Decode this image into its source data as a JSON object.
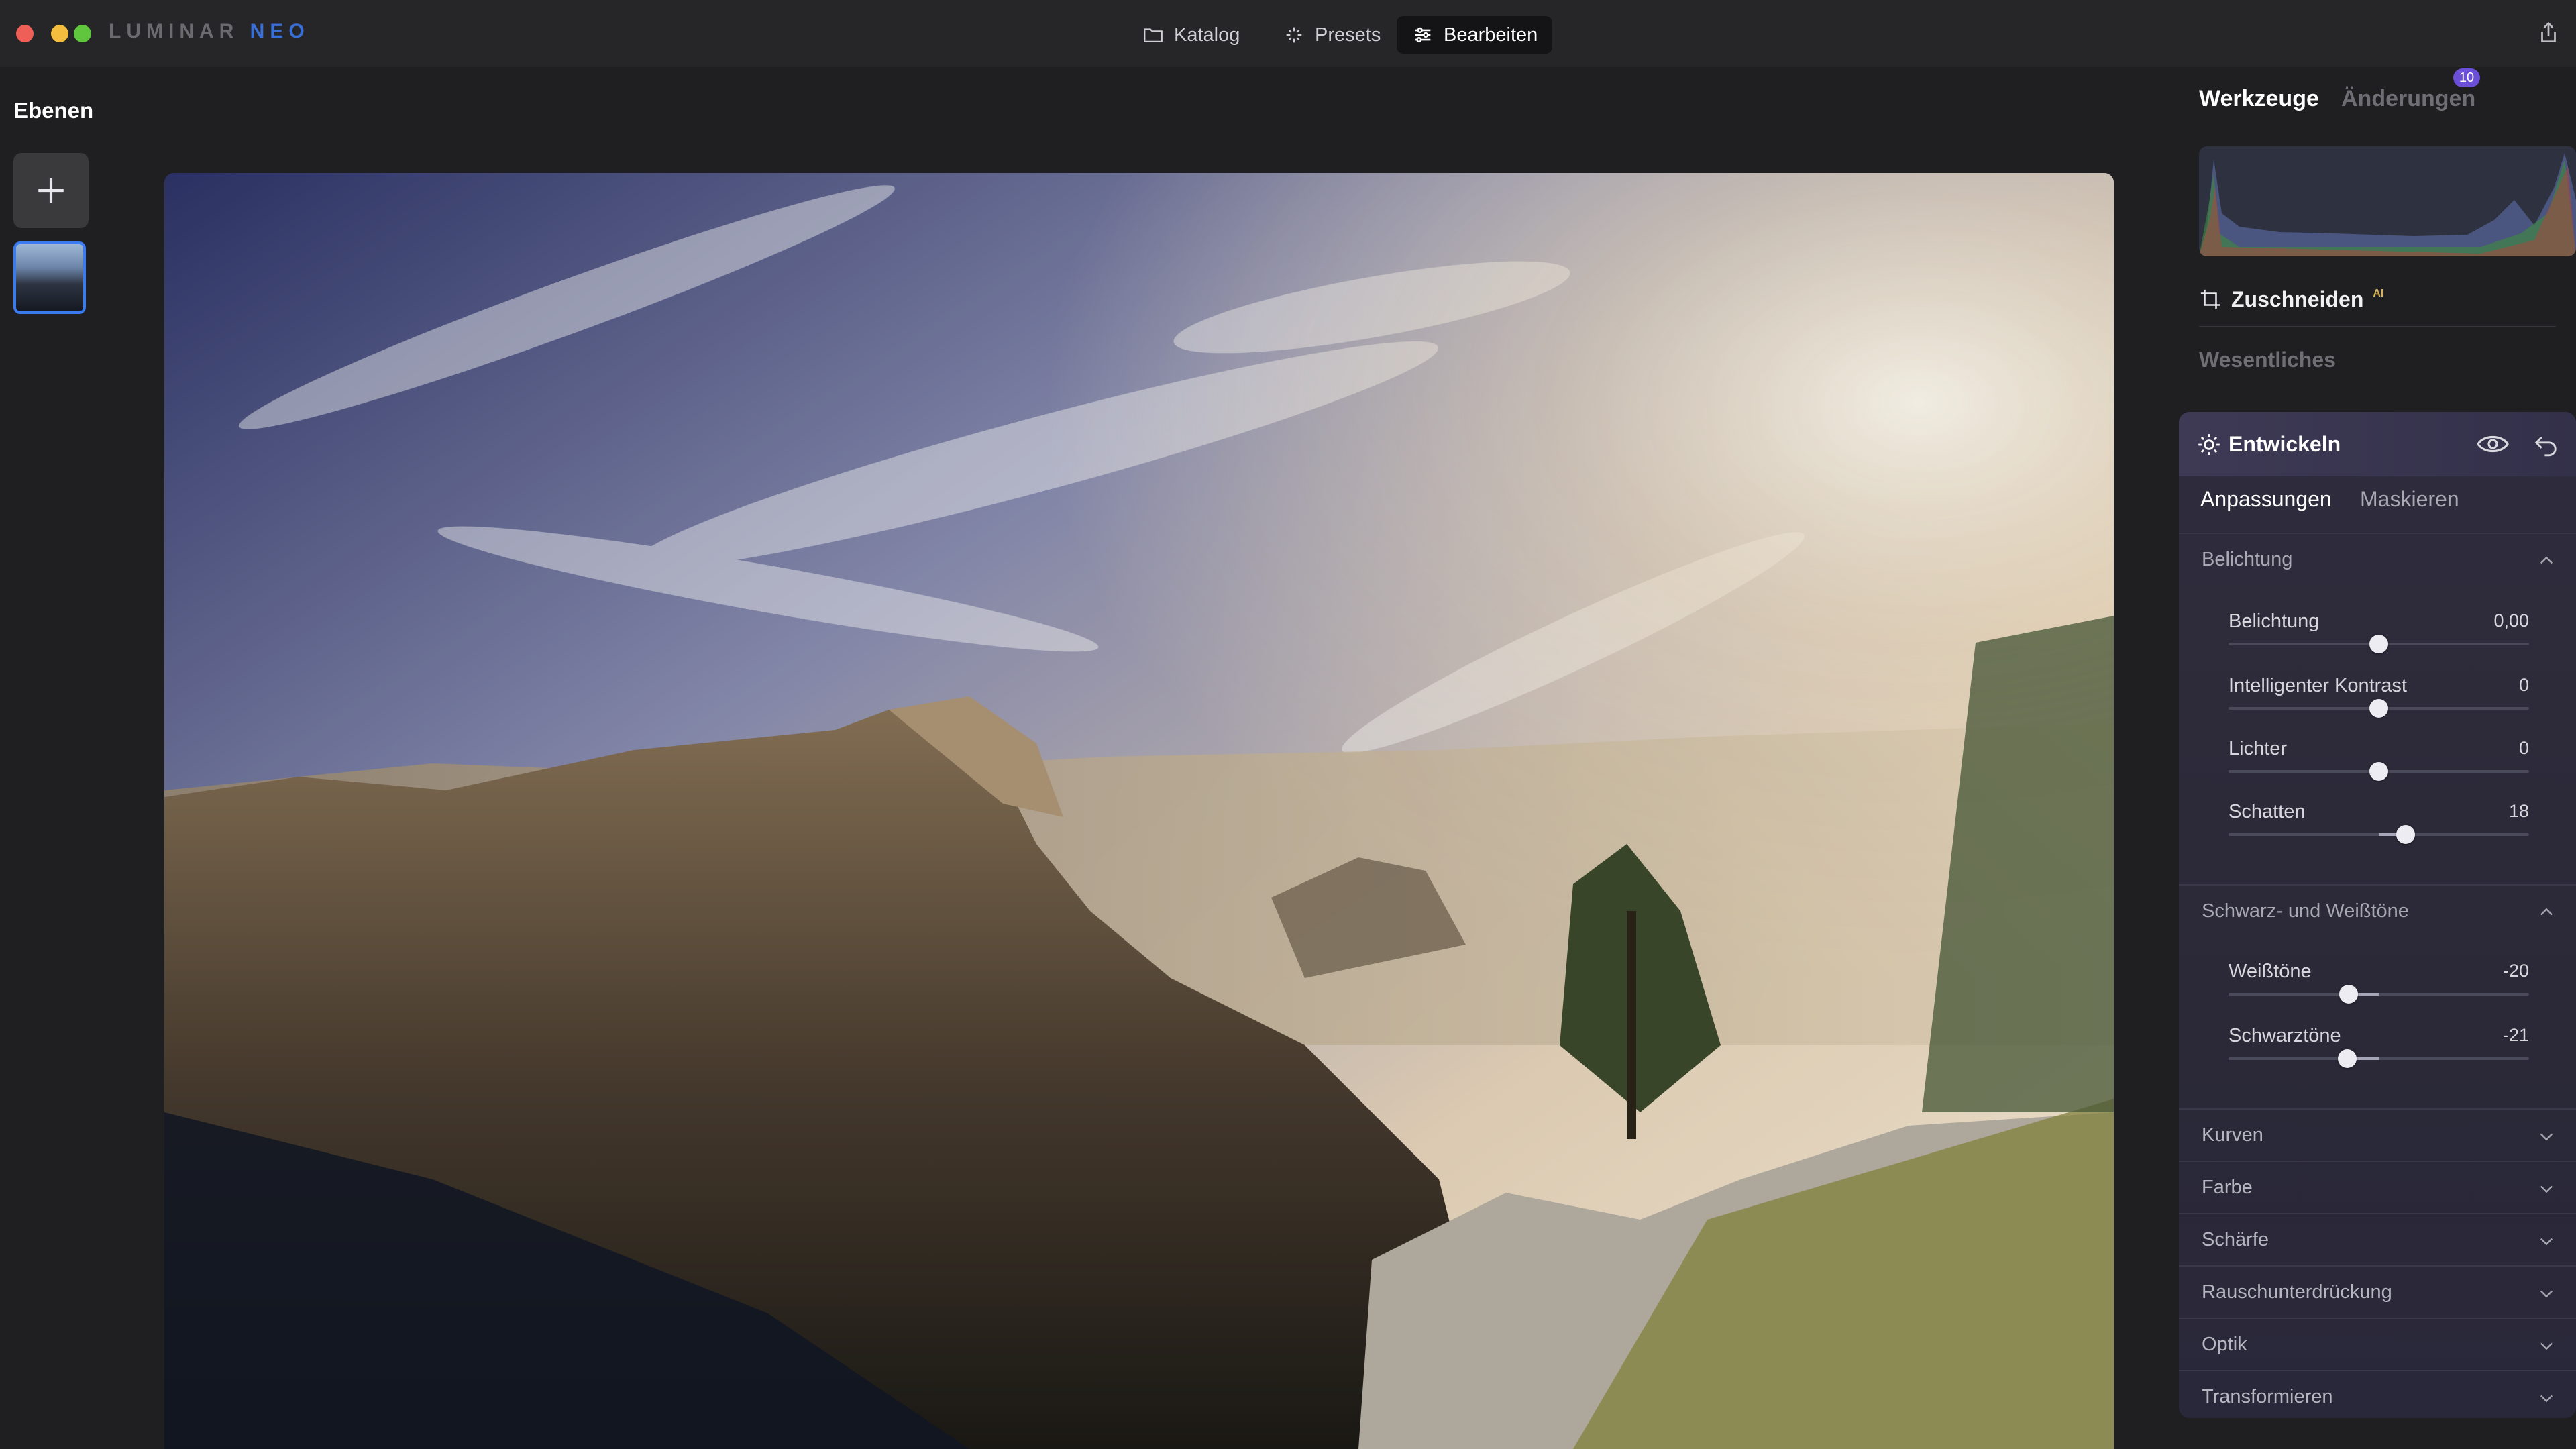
{
  "app": {
    "logo_main": "LUMINAR",
    "logo_accent": "NEO"
  },
  "colors": {
    "accent": "#3b7bf0",
    "badge": "#6b4fd8",
    "ai_tag": "#d6b35c"
  },
  "nav": {
    "catalog": {
      "label": "Katalog",
      "icon": "folder-icon"
    },
    "presets": {
      "label": "Presets",
      "icon": "sparkle-icon"
    },
    "edit": {
      "label": "Bearbeiten",
      "icon": "sliders-icon"
    }
  },
  "layers": {
    "title": "Ebenen"
  },
  "right": {
    "tab_tools": "Werkzeuge",
    "tab_changes": "Änderungen",
    "changes_count": "10",
    "crop_label": "Zuschneiden",
    "crop_ai": "AI",
    "essentials": "Wesentliches"
  },
  "tool": {
    "title": "Entwickeln",
    "subtab_adjust": "Anpassungen",
    "subtab_mask": "Maskieren",
    "section_exposure": "Belichtung",
    "section_bw": "Schwarz- und Weißtöne",
    "sliders": [
      {
        "label": "Belichtung",
        "value": "0,00",
        "position": 0.5
      },
      {
        "label": "Intelligenter Kontrast",
        "value": "0",
        "position": 0.5
      },
      {
        "label": "Lichter",
        "value": "0",
        "position": 0.5
      },
      {
        "label": "Schatten",
        "value": "18",
        "position": 0.59
      }
    ],
    "bw_sliders": [
      {
        "label": "Weißtöne",
        "value": "-20",
        "position": 0.4
      },
      {
        "label": "Schwarztöne",
        "value": "-21",
        "position": 0.395
      }
    ],
    "collapsed_sections": [
      "Kurven",
      "Farbe",
      "Schärfe",
      "Rauschunterdrückung",
      "Optik",
      "Transformieren"
    ]
  }
}
